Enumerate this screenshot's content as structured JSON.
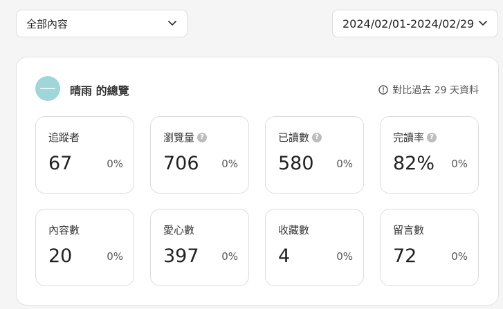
{
  "filters": {
    "content_select_value": "全部內容",
    "date_range_value": "2024/02/01-2024/02/29"
  },
  "overview": {
    "owner_title": "晴雨 的總覽",
    "compare_note": "對比過去 29 天資料",
    "metrics": [
      {
        "label": "追蹤者",
        "value": "67",
        "change": "0%",
        "has_help": false
      },
      {
        "label": "瀏覽量",
        "value": "706",
        "change": "0%",
        "has_help": true
      },
      {
        "label": "已讀數",
        "value": "580",
        "change": "0%",
        "has_help": true
      },
      {
        "label": "完讀率",
        "value": "82%",
        "change": "0%",
        "has_help": true
      },
      {
        "label": "內容數",
        "value": "20",
        "change": "0%",
        "has_help": false
      },
      {
        "label": "愛心數",
        "value": "397",
        "change": "0%",
        "has_help": false
      },
      {
        "label": "收藏數",
        "value": "4",
        "change": "0%",
        "has_help": false
      },
      {
        "label": "留言數",
        "value": "72",
        "change": "0%",
        "has_help": false
      }
    ]
  },
  "icons": {
    "help": "question-circle-icon",
    "info": "info-circle-icon",
    "dropdown": "chevron-down-icon"
  },
  "colors": {
    "avatar_bg": "#9fd6d9",
    "help_icon": "#bdbdbd",
    "card_border": "#dcdcdc"
  }
}
